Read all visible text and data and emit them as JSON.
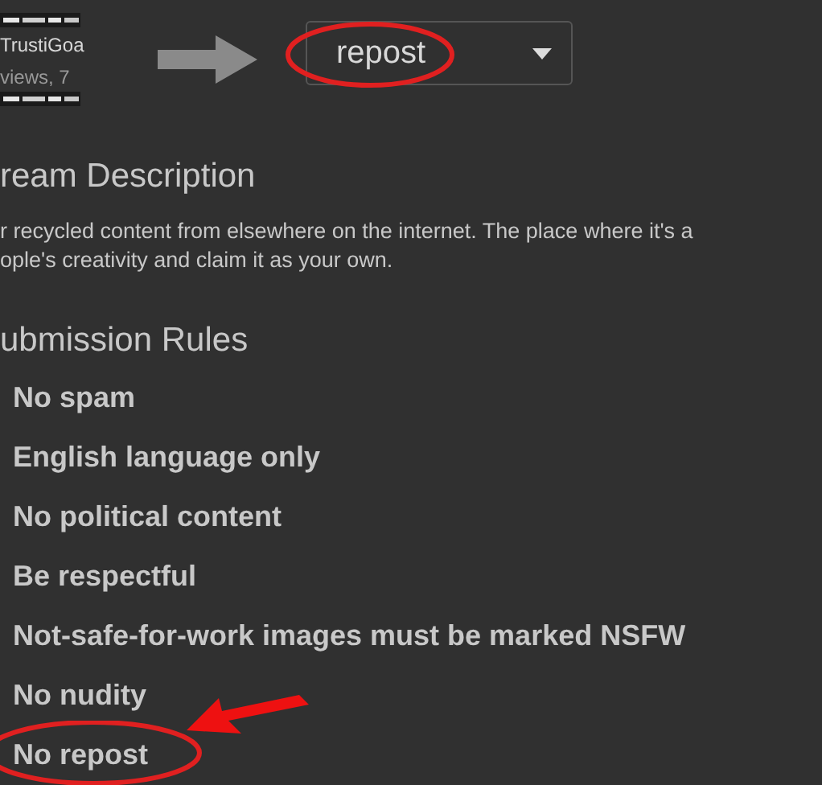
{
  "stream": {
    "owner": "TrustiGoa",
    "views": "views, 7"
  },
  "type_select": {
    "value": "repost"
  },
  "description": {
    "heading": "ream Description",
    "lines": [
      "r recycled content from elsewhere on the internet. The place where it's a",
      "ople's creativity and claim it as your own."
    ]
  },
  "rules": {
    "heading": "ubmission Rules",
    "items": [
      "No spam",
      "English language only",
      "No political content",
      "Be respectful",
      "Not-safe-for-work images must be marked NSFW",
      "No nudity",
      "No repost"
    ]
  }
}
